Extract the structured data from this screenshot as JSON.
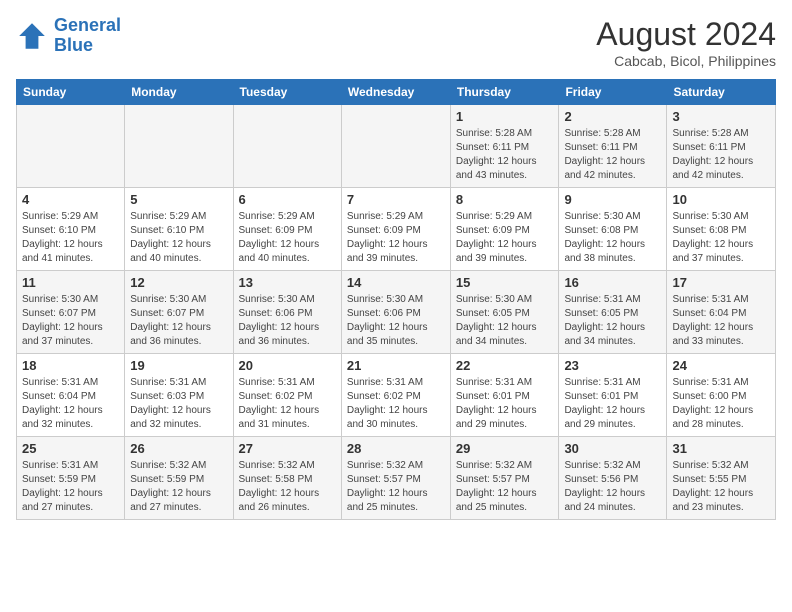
{
  "header": {
    "logo_line1": "General",
    "logo_line2": "Blue",
    "title": "August 2024",
    "subtitle": "Cabcab, Bicol, Philippines"
  },
  "days_of_week": [
    "Sunday",
    "Monday",
    "Tuesday",
    "Wednesday",
    "Thursday",
    "Friday",
    "Saturday"
  ],
  "weeks": [
    [
      {
        "day": "",
        "info": ""
      },
      {
        "day": "",
        "info": ""
      },
      {
        "day": "",
        "info": ""
      },
      {
        "day": "",
        "info": ""
      },
      {
        "day": "1",
        "info": "Sunrise: 5:28 AM\nSunset: 6:11 PM\nDaylight: 12 hours\nand 43 minutes."
      },
      {
        "day": "2",
        "info": "Sunrise: 5:28 AM\nSunset: 6:11 PM\nDaylight: 12 hours\nand 42 minutes."
      },
      {
        "day": "3",
        "info": "Sunrise: 5:28 AM\nSunset: 6:11 PM\nDaylight: 12 hours\nand 42 minutes."
      }
    ],
    [
      {
        "day": "4",
        "info": "Sunrise: 5:29 AM\nSunset: 6:10 PM\nDaylight: 12 hours\nand 41 minutes."
      },
      {
        "day": "5",
        "info": "Sunrise: 5:29 AM\nSunset: 6:10 PM\nDaylight: 12 hours\nand 40 minutes."
      },
      {
        "day": "6",
        "info": "Sunrise: 5:29 AM\nSunset: 6:09 PM\nDaylight: 12 hours\nand 40 minutes."
      },
      {
        "day": "7",
        "info": "Sunrise: 5:29 AM\nSunset: 6:09 PM\nDaylight: 12 hours\nand 39 minutes."
      },
      {
        "day": "8",
        "info": "Sunrise: 5:29 AM\nSunset: 6:09 PM\nDaylight: 12 hours\nand 39 minutes."
      },
      {
        "day": "9",
        "info": "Sunrise: 5:30 AM\nSunset: 6:08 PM\nDaylight: 12 hours\nand 38 minutes."
      },
      {
        "day": "10",
        "info": "Sunrise: 5:30 AM\nSunset: 6:08 PM\nDaylight: 12 hours\nand 37 minutes."
      }
    ],
    [
      {
        "day": "11",
        "info": "Sunrise: 5:30 AM\nSunset: 6:07 PM\nDaylight: 12 hours\nand 37 minutes."
      },
      {
        "day": "12",
        "info": "Sunrise: 5:30 AM\nSunset: 6:07 PM\nDaylight: 12 hours\nand 36 minutes."
      },
      {
        "day": "13",
        "info": "Sunrise: 5:30 AM\nSunset: 6:06 PM\nDaylight: 12 hours\nand 36 minutes."
      },
      {
        "day": "14",
        "info": "Sunrise: 5:30 AM\nSunset: 6:06 PM\nDaylight: 12 hours\nand 35 minutes."
      },
      {
        "day": "15",
        "info": "Sunrise: 5:30 AM\nSunset: 6:05 PM\nDaylight: 12 hours\nand 34 minutes."
      },
      {
        "day": "16",
        "info": "Sunrise: 5:31 AM\nSunset: 6:05 PM\nDaylight: 12 hours\nand 34 minutes."
      },
      {
        "day": "17",
        "info": "Sunrise: 5:31 AM\nSunset: 6:04 PM\nDaylight: 12 hours\nand 33 minutes."
      }
    ],
    [
      {
        "day": "18",
        "info": "Sunrise: 5:31 AM\nSunset: 6:04 PM\nDaylight: 12 hours\nand 32 minutes."
      },
      {
        "day": "19",
        "info": "Sunrise: 5:31 AM\nSunset: 6:03 PM\nDaylight: 12 hours\nand 32 minutes."
      },
      {
        "day": "20",
        "info": "Sunrise: 5:31 AM\nSunset: 6:02 PM\nDaylight: 12 hours\nand 31 minutes."
      },
      {
        "day": "21",
        "info": "Sunrise: 5:31 AM\nSunset: 6:02 PM\nDaylight: 12 hours\nand 30 minutes."
      },
      {
        "day": "22",
        "info": "Sunrise: 5:31 AM\nSunset: 6:01 PM\nDaylight: 12 hours\nand 29 minutes."
      },
      {
        "day": "23",
        "info": "Sunrise: 5:31 AM\nSunset: 6:01 PM\nDaylight: 12 hours\nand 29 minutes."
      },
      {
        "day": "24",
        "info": "Sunrise: 5:31 AM\nSunset: 6:00 PM\nDaylight: 12 hours\nand 28 minutes."
      }
    ],
    [
      {
        "day": "25",
        "info": "Sunrise: 5:31 AM\nSunset: 5:59 PM\nDaylight: 12 hours\nand 27 minutes."
      },
      {
        "day": "26",
        "info": "Sunrise: 5:32 AM\nSunset: 5:59 PM\nDaylight: 12 hours\nand 27 minutes."
      },
      {
        "day": "27",
        "info": "Sunrise: 5:32 AM\nSunset: 5:58 PM\nDaylight: 12 hours\nand 26 minutes."
      },
      {
        "day": "28",
        "info": "Sunrise: 5:32 AM\nSunset: 5:57 PM\nDaylight: 12 hours\nand 25 minutes."
      },
      {
        "day": "29",
        "info": "Sunrise: 5:32 AM\nSunset: 5:57 PM\nDaylight: 12 hours\nand 25 minutes."
      },
      {
        "day": "30",
        "info": "Sunrise: 5:32 AM\nSunset: 5:56 PM\nDaylight: 12 hours\nand 24 minutes."
      },
      {
        "day": "31",
        "info": "Sunrise: 5:32 AM\nSunset: 5:55 PM\nDaylight: 12 hours\nand 23 minutes."
      }
    ]
  ]
}
